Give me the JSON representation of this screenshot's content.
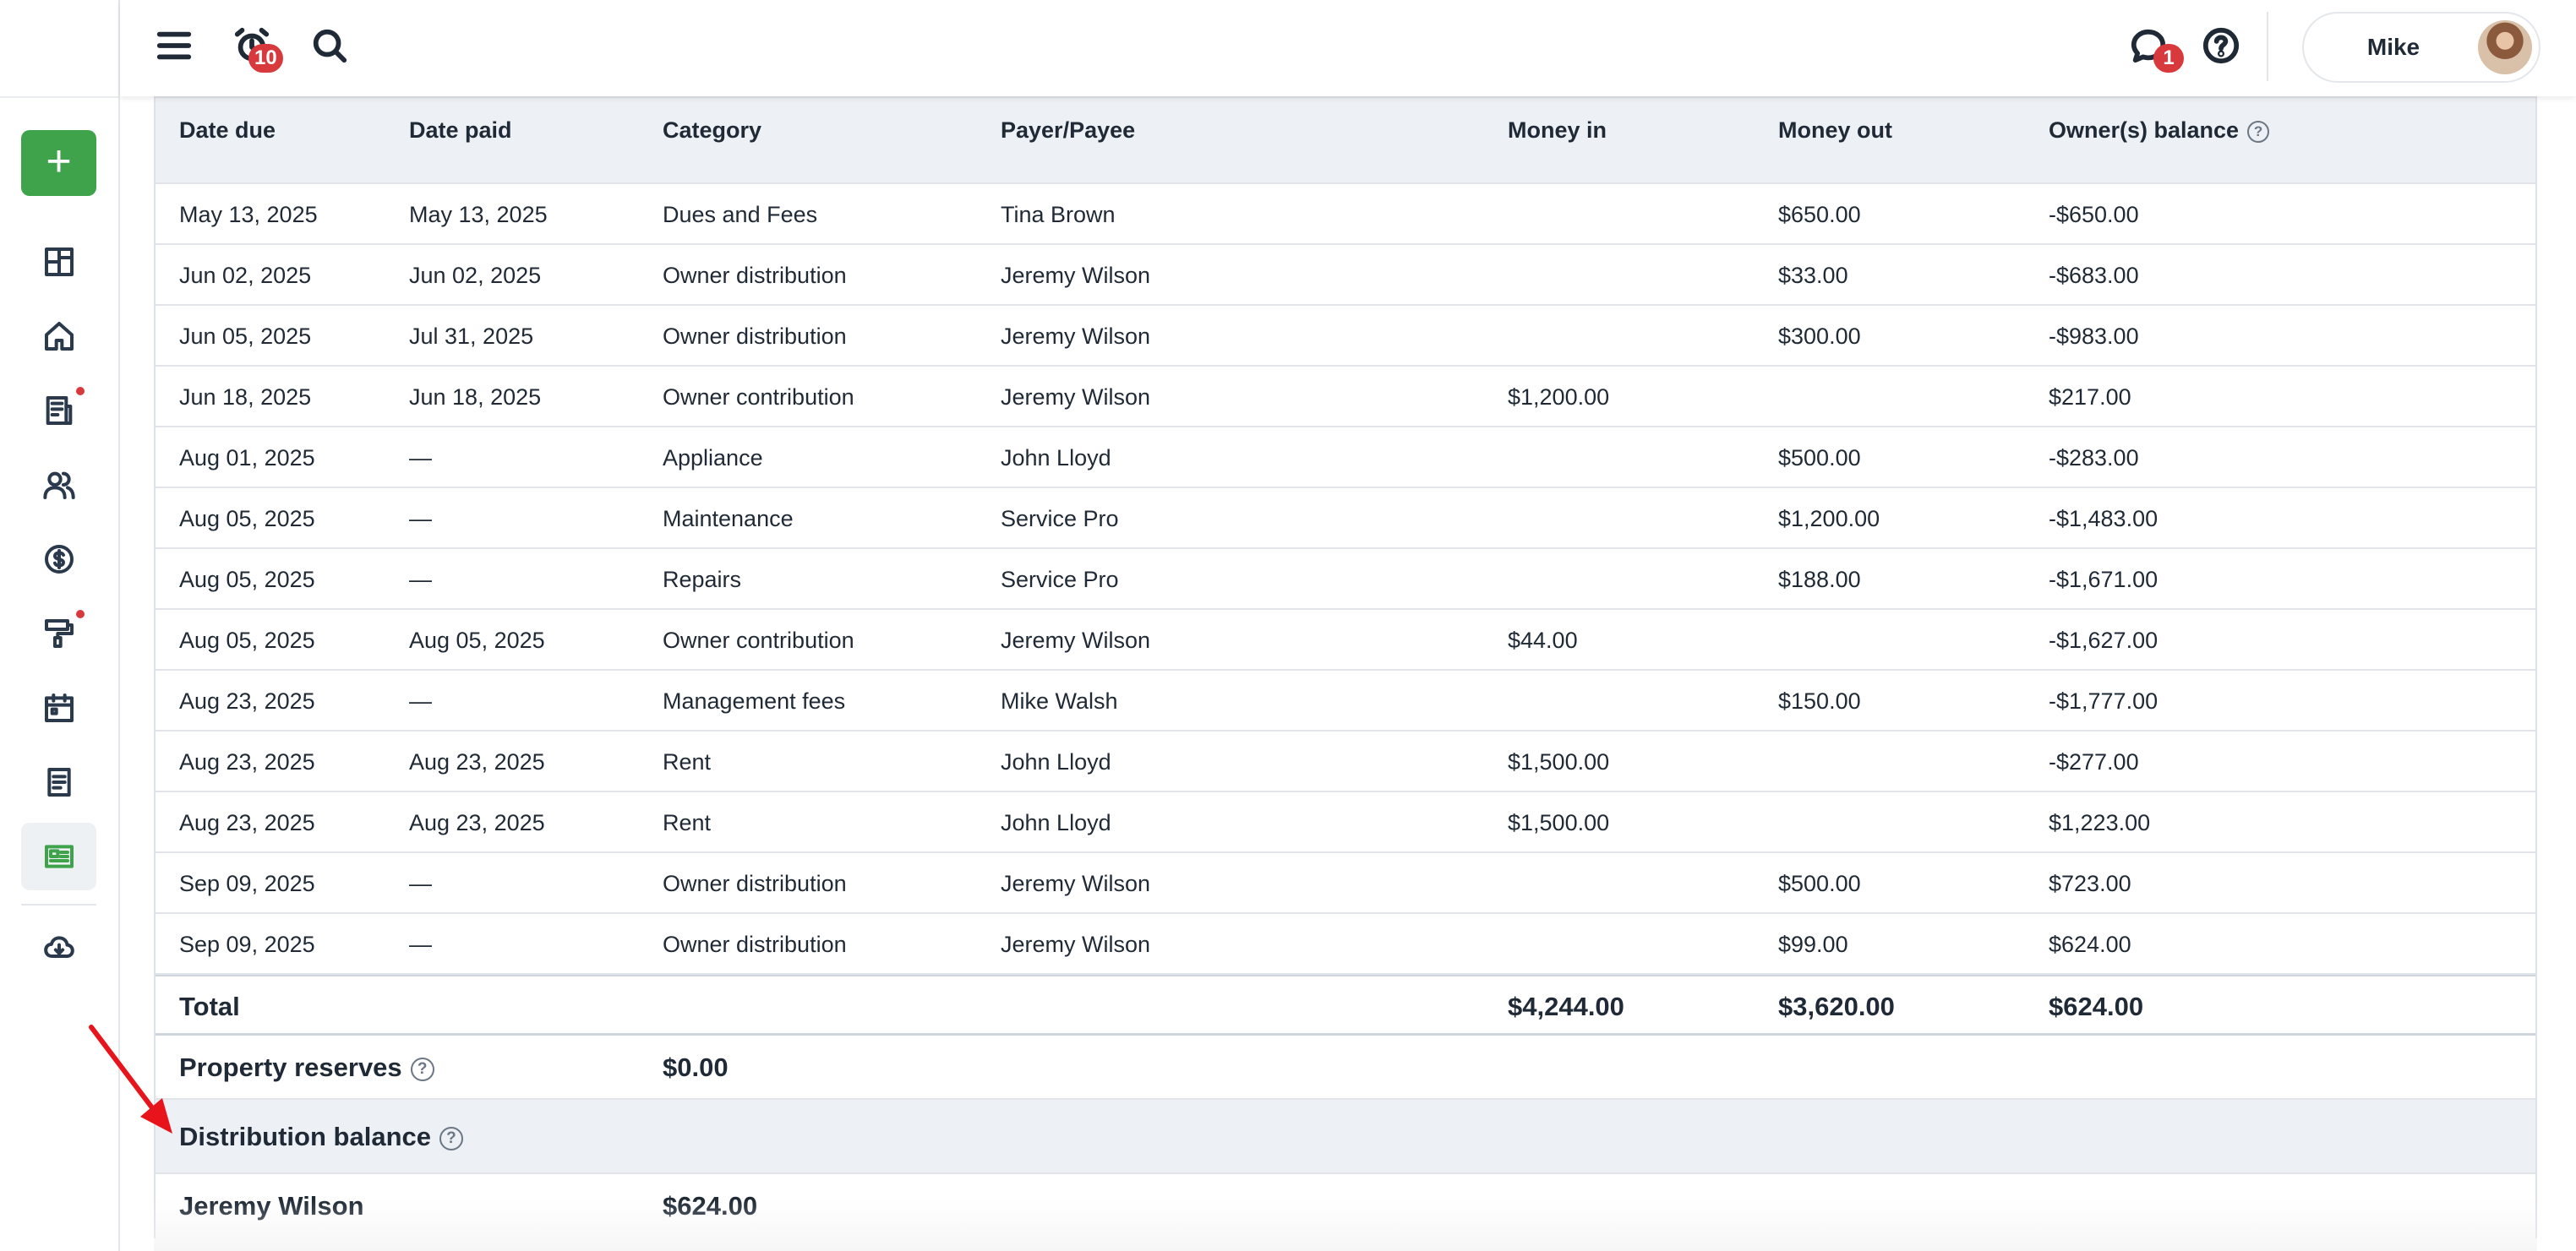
{
  "topbar": {
    "notifications_count": "10",
    "messages_count": "1",
    "user_name": "Mike"
  },
  "icons": {
    "menu": "hamburger-icon",
    "alarm": "alarm-clock-icon",
    "search": "search-icon",
    "chat": "chat-bubble-icon",
    "help": "help-circle-icon"
  },
  "sidebar": {
    "add_label": "+",
    "items": [
      {
        "name": "dashboard",
        "icon": "dashboard-icon"
      },
      {
        "name": "properties",
        "icon": "home-icon"
      },
      {
        "name": "leases",
        "icon": "document-building-icon",
        "dot": true
      },
      {
        "name": "people",
        "icon": "people-icon"
      },
      {
        "name": "accounting",
        "icon": "dollar-circle-icon"
      },
      {
        "name": "maintenance",
        "icon": "paint-roller-icon",
        "dot": true
      },
      {
        "name": "calendar",
        "icon": "calendar-icon"
      },
      {
        "name": "reports",
        "icon": "report-icon"
      },
      {
        "name": "statements",
        "icon": "statement-icon",
        "active": true
      },
      {
        "name": "download",
        "icon": "cloud-download-icon"
      }
    ]
  },
  "table": {
    "headers": {
      "date_due": "Date due",
      "date_paid": "Date paid",
      "category": "Category",
      "payer": "Payer/Payee",
      "money_in": "Money in",
      "money_out": "Money out",
      "balance": "Owner(s) balance"
    },
    "rows": [
      {
        "due": "May 13, 2025",
        "paid": "May 13, 2025",
        "category": "Dues and Fees",
        "payer": "Tina Brown",
        "in": "",
        "out": "$650.00",
        "balance": "-$650.00"
      },
      {
        "due": "Jun 02, 2025",
        "paid": "Jun 02, 2025",
        "category": "Owner distribution",
        "payer": "Jeremy Wilson",
        "in": "",
        "out": "$33.00",
        "balance": "-$683.00"
      },
      {
        "due": "Jun 05, 2025",
        "paid": "Jul 31, 2025",
        "category": "Owner distribution",
        "payer": "Jeremy Wilson",
        "in": "",
        "out": "$300.00",
        "balance": "-$983.00"
      },
      {
        "due": "Jun 18, 2025",
        "paid": "Jun 18, 2025",
        "category": "Owner contribution",
        "payer": "Jeremy Wilson",
        "in": "$1,200.00",
        "out": "",
        "balance": "$217.00"
      },
      {
        "due": "Aug 01, 2025",
        "paid": "—",
        "category": "Appliance",
        "payer": "John Lloyd",
        "in": "",
        "out": "$500.00",
        "balance": "-$283.00"
      },
      {
        "due": "Aug 05, 2025",
        "paid": "—",
        "category": "Maintenance",
        "payer": "Service Pro",
        "in": "",
        "out": "$1,200.00",
        "balance": "-$1,483.00"
      },
      {
        "due": "Aug 05, 2025",
        "paid": "—",
        "category": "Repairs",
        "payer": "Service Pro",
        "in": "",
        "out": "$188.00",
        "balance": "-$1,671.00"
      },
      {
        "due": "Aug 05, 2025",
        "paid": "Aug 05, 2025",
        "category": "Owner contribution",
        "payer": "Jeremy Wilson",
        "in": "$44.00",
        "out": "",
        "balance": "-$1,627.00"
      },
      {
        "due": "Aug 23, 2025",
        "paid": "—",
        "category": "Management fees",
        "payer": "Mike Walsh",
        "in": "",
        "out": "$150.00",
        "balance": "-$1,777.00"
      },
      {
        "due": "Aug 23, 2025",
        "paid": "Aug 23, 2025",
        "category": "Rent",
        "payer": "John Lloyd",
        "in": "$1,500.00",
        "out": "",
        "balance": "-$277.00"
      },
      {
        "due": "Aug 23, 2025",
        "paid": "Aug 23, 2025",
        "category": "Rent",
        "payer": "John Lloyd",
        "in": "$1,500.00",
        "out": "",
        "balance": "$1,223.00"
      },
      {
        "due": "Sep 09, 2025",
        "paid": "—",
        "category": "Owner distribution",
        "payer": "Jeremy Wilson",
        "in": "",
        "out": "$500.00",
        "balance": "$723.00"
      },
      {
        "due": "Sep 09, 2025",
        "paid": "—",
        "category": "Owner distribution",
        "payer": "Jeremy Wilson",
        "in": "",
        "out": "$99.00",
        "balance": "$624.00"
      }
    ],
    "total": {
      "label": "Total",
      "in": "$4,244.00",
      "out": "$3,620.00",
      "balance": "$624.00"
    }
  },
  "reserves": {
    "label": "Property reserves",
    "value": "$0.00"
  },
  "distribution": {
    "label": "Distribution balance",
    "owners": [
      {
        "name": "Jeremy Wilson",
        "value": "$624.00"
      }
    ]
  },
  "colors": {
    "accent": "#3ea34a",
    "badge": "#d8393d",
    "annotation_arrow": "#e8141c"
  }
}
